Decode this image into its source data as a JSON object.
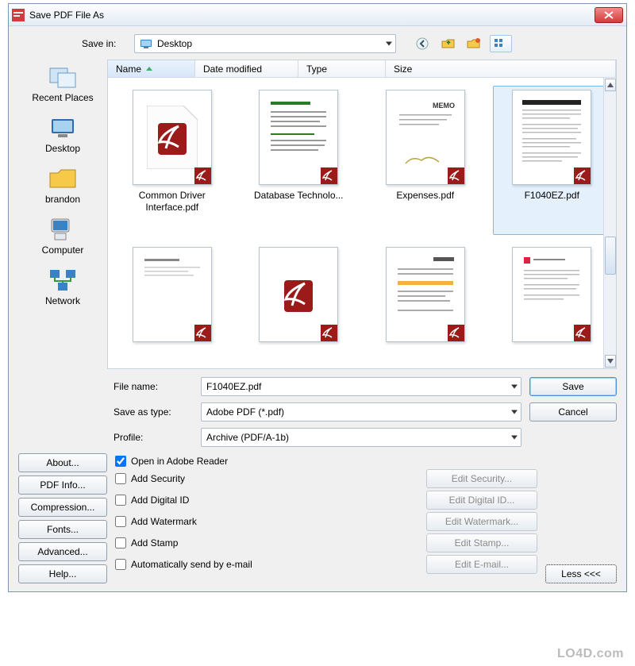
{
  "titlebar": {
    "title": "Save PDF File As"
  },
  "savein": {
    "label": "Save in:",
    "value": "Desktop"
  },
  "places": [
    {
      "label": "Recent Places"
    },
    {
      "label": "Desktop"
    },
    {
      "label": "brandon"
    },
    {
      "label": "Computer"
    },
    {
      "label": "Network"
    }
  ],
  "headers": {
    "name": "Name",
    "date": "Date modified",
    "type": "Type",
    "size": "Size"
  },
  "files": [
    {
      "name": "Common Driver Interface.pdf",
      "kind": "pdficon"
    },
    {
      "name": "Database Technolo...",
      "kind": "text-green"
    },
    {
      "name": "Expenses.pdf",
      "kind": "memo"
    },
    {
      "name": "F1040EZ.pdf",
      "kind": "form",
      "selected": true
    },
    {
      "name": "",
      "kind": "text-gray"
    },
    {
      "name": "",
      "kind": "pdficon"
    },
    {
      "name": "",
      "kind": "text-yellow"
    },
    {
      "name": "",
      "kind": "text-gray2"
    }
  ],
  "fields": {
    "filename_label": "File name:",
    "filename_value": "F1040EZ.pdf",
    "saveastype_label": "Save as type:",
    "saveastype_value": "Adobe PDF (*.pdf)",
    "profile_label": "Profile:",
    "profile_value": "Archive (PDF/A-1b)"
  },
  "buttons": {
    "save": "Save",
    "cancel": "Cancel",
    "about": "About...",
    "pdfinfo": "PDF Info...",
    "compression": "Compression...",
    "fonts": "Fonts...",
    "advanced": "Advanced...",
    "help": "Help...",
    "edit_security": "Edit Security...",
    "edit_digitalid": "Edit Digital ID...",
    "edit_watermark": "Edit Watermark...",
    "edit_stamp": "Edit Stamp...",
    "edit_email": "Edit E-mail...",
    "less": "Less <<<"
  },
  "checks": {
    "open_reader": "Open in Adobe Reader",
    "add_security": "Add Security",
    "add_digitalid": "Add Digital ID",
    "add_watermark": "Add Watermark",
    "add_stamp": "Add Stamp",
    "auto_email": "Automatically send by e-mail"
  },
  "watermark": "LO4D.com"
}
